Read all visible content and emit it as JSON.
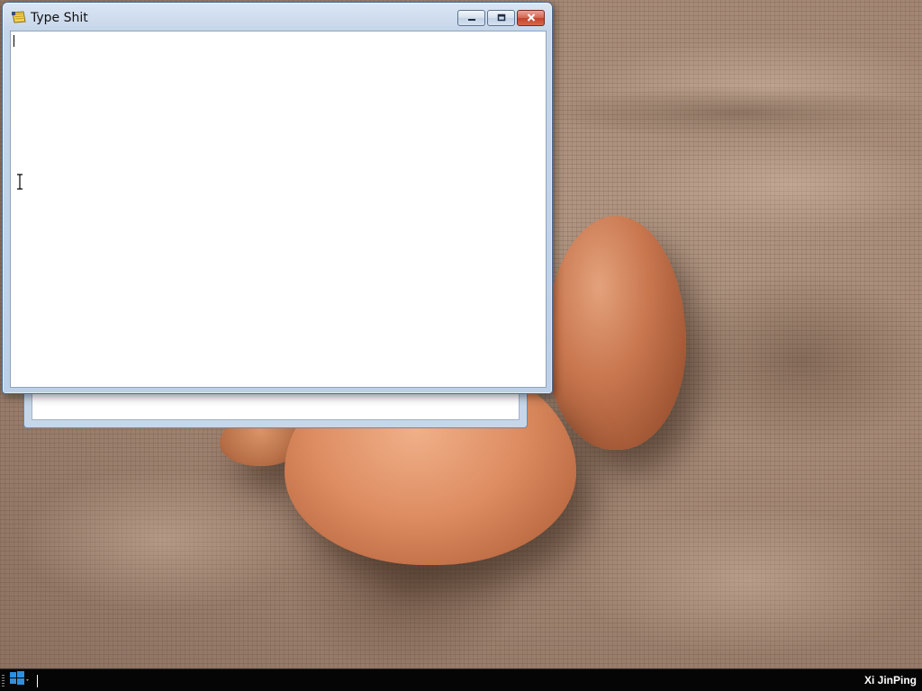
{
  "window": {
    "title": "Type Shit",
    "icon": "notepad-icon",
    "content_text": "",
    "buttons": {
      "minimize": "minimize-icon",
      "maximize": "maximize-icon",
      "close": "close-icon"
    }
  },
  "taskbar": {
    "start_icon": "windows-logo-icon",
    "user_name": "Xi JinPing"
  },
  "colors": {
    "taskbar_background": "#050505",
    "close_button": "#c2432b",
    "window_frame": "#c6d6ea"
  }
}
